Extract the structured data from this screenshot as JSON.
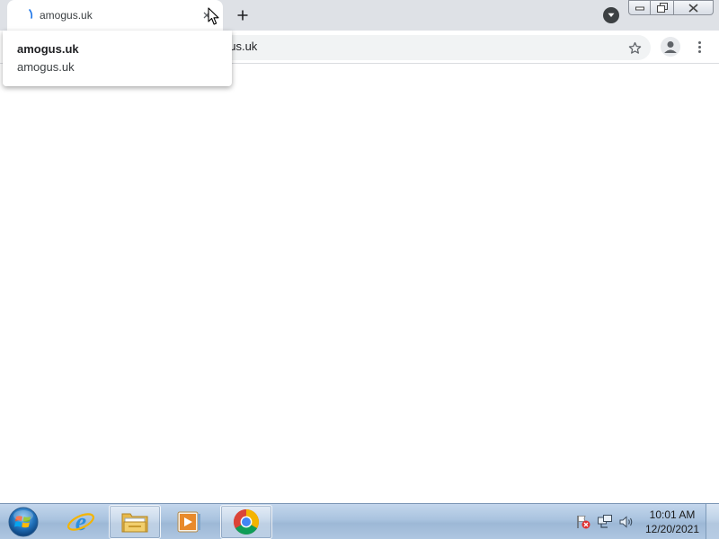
{
  "browser": {
    "tab": {
      "title": "amogus.uk",
      "close_icon": "close-icon"
    },
    "new_tab_icon": "plus-icon",
    "tab_search_icon": "chevron-down-icon",
    "window_controls": {
      "minimize_icon": "minimize-icon",
      "restore_icon": "restore-icon",
      "close_icon": "close-icon"
    },
    "omnibox": {
      "url": "amogus.uk",
      "visible_text": "gus.uk"
    },
    "bookmark_icon": "star-icon",
    "profile_icon": "person-icon",
    "menu_icon": "vertical-dots-icon"
  },
  "hovercard": {
    "title": "amogus.uk",
    "domain": "amogus.uk"
  },
  "taskbar": {
    "start_icon": "windows-orb-icon",
    "pinned": [
      {
        "name": "internet-explorer",
        "icon": "ie-icon"
      },
      {
        "name": "file-explorer",
        "icon": "folder-icon"
      },
      {
        "name": "media-player",
        "icon": "media-player-icon"
      },
      {
        "name": "chrome",
        "icon": "chrome-icon",
        "active": true
      }
    ],
    "tray": [
      "action-center-flag-icon",
      "network-icon",
      "volume-icon"
    ],
    "clock": {
      "time": "10:01 AM",
      "date": "12/20/2021"
    }
  },
  "colors": {
    "tabstrip": "#dee1e6",
    "toolbar": "#ffffff",
    "omnibox": "#f1f3f4",
    "taskbar": "#a9c3df"
  }
}
